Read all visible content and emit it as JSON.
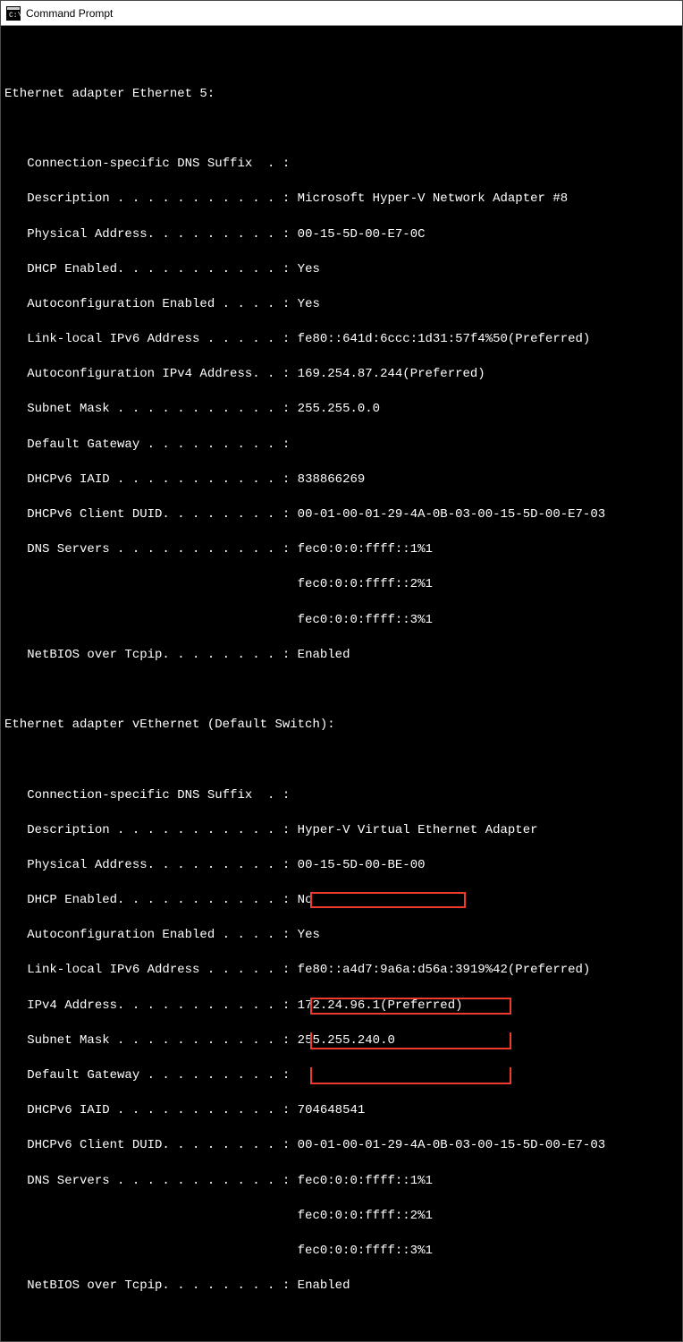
{
  "window": {
    "title": "Command Prompt"
  },
  "adapter1": {
    "header": "Ethernet adapter Ethernet 5:",
    "dns_suffix_label": "   Connection-specific DNS Suffix  . :",
    "description_label": "   Description . . . . . . . . . . . :",
    "description_value": " Microsoft Hyper-V Network Adapter #8",
    "physaddr_label": "   Physical Address. . . . . . . . . :",
    "physaddr_value": " 00-15-5D-00-E7-0C",
    "dhcp_label": "   DHCP Enabled. . . . . . . . . . . :",
    "dhcp_value": " Yes",
    "autoconf_label": "   Autoconfiguration Enabled . . . . :",
    "autoconf_value": " Yes",
    "llv6_label": "   Link-local IPv6 Address . . . . . :",
    "llv6_value": " fe80::641d:6ccc:1d31:57f4%50(Preferred)",
    "autov4_label": "   Autoconfiguration IPv4 Address. . :",
    "autov4_value": " 169.254.87.244(Preferred)",
    "subnet_label": "   Subnet Mask . . . . . . . . . . . :",
    "subnet_value": " 255.255.0.0",
    "gateway_label": "   Default Gateway . . . . . . . . . :",
    "iaid_label": "   DHCPv6 IAID . . . . . . . . . . . :",
    "iaid_value": " 838866269",
    "duid_label": "   DHCPv6 Client DUID. . . . . . . . :",
    "duid_value": " 00-01-00-01-29-4A-0B-03-00-15-5D-00-E7-03",
    "dns_label": "   DNS Servers . . . . . . . . . . . :",
    "dns1": " fec0:0:0:ffff::1%1",
    "dns2": "                                       fec0:0:0:ffff::2%1",
    "dns3": "                                       fec0:0:0:ffff::3%1",
    "netbios_label": "   NetBIOS over Tcpip. . . . . . . . :",
    "netbios_value": " Enabled"
  },
  "adapter2": {
    "header": "Ethernet adapter vEthernet (Default Switch):",
    "dns_suffix_label": "   Connection-specific DNS Suffix  . :",
    "description_label": "   Description . . . . . . . . . . . :",
    "description_value": " Hyper-V Virtual Ethernet Adapter",
    "physaddr_label": "   Physical Address. . . . . . . . . :",
    "physaddr_value": " 00-15-5D-00-BE-00",
    "dhcp_label": "   DHCP Enabled. . . . . . . . . . . :",
    "dhcp_value": " No",
    "autoconf_label": "   Autoconfiguration Enabled . . . . :",
    "autoconf_value": " Yes",
    "llv6_label": "   Link-local IPv6 Address . . . . . :",
    "llv6_value": " fe80::a4d7:9a6a:d56a:3919%42(Preferred)",
    "ipv4_label": "   IPv4 Address. . . . . . . . . . . :",
    "ipv4_value": " 172.24.96.1(Preferred)",
    "subnet_label": "   Subnet Mask . . . . . . . . . . . :",
    "subnet_value": " 255.255.240.0",
    "gateway_label": "   Default Gateway . . . . . . . . . :",
    "iaid_label": "   DHCPv6 IAID . . . . . . . . . . . :",
    "iaid_value": " 704648541",
    "duid_label": "   DHCPv6 Client DUID. . . . . . . . :",
    "duid_value": " 00-01-00-01-29-4A-0B-03-00-15-5D-00-E7-03",
    "dns_label": "   DNS Servers . . . . . . . . . . . :",
    "dns1": " fec0:0:0:ffff::1%1",
    "dns2": "                                       fec0:0:0:ffff::2%1",
    "dns3": "                                       fec0:0:0:ffff::3%1",
    "netbios_label": "   NetBIOS over Tcpip. . . . . . . . :",
    "netbios_value": " Enabled"
  }
}
